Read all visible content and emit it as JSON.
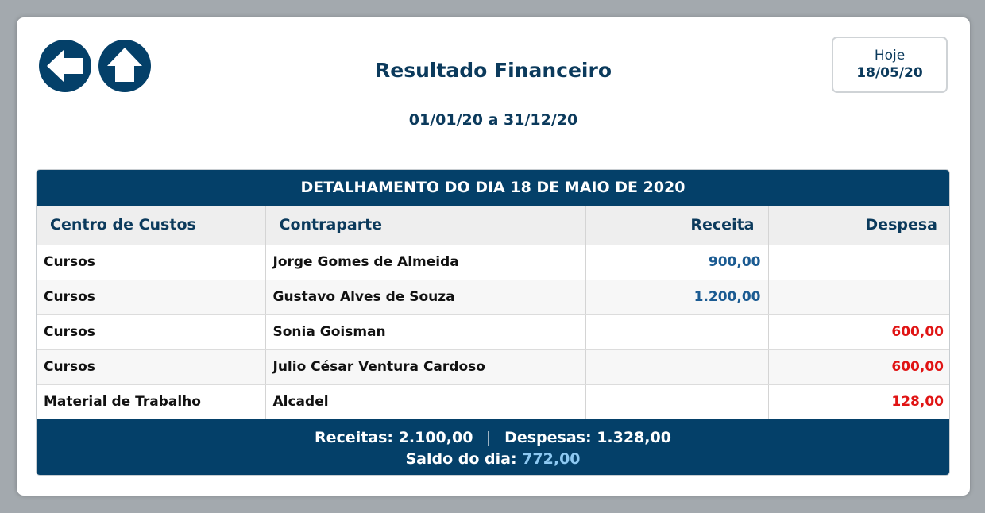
{
  "header": {
    "title": "Resultado Financeiro",
    "period": "01/01/20 a 31/12/20",
    "today_label": "Hoje",
    "today_date": "18/05/20"
  },
  "nav": {
    "back_icon": "arrow-left-icon",
    "home_icon": "arrow-up-icon"
  },
  "table": {
    "title": "DETALHAMENTO DO DIA 18 DE MAIO DE 2020",
    "columns": [
      "Centro de Custos",
      "Contraparte",
      "Receita",
      "Despesa"
    ],
    "rows": [
      {
        "centro": "Cursos",
        "contraparte": "Jorge Gomes de Almeida",
        "receita": "900,00",
        "despesa": ""
      },
      {
        "centro": "Cursos",
        "contraparte": "Gustavo Alves de Souza",
        "receita": "1.200,00",
        "despesa": ""
      },
      {
        "centro": "Cursos",
        "contraparte": "Sonia Goisman",
        "receita": "",
        "despesa": "600,00"
      },
      {
        "centro": "Cursos",
        "contraparte": "Julio César Ventura Cardoso",
        "receita": "",
        "despesa": "600,00"
      },
      {
        "centro": "Material de Trabalho",
        "contraparte": "Alcadel",
        "receita": "",
        "despesa": "128,00"
      }
    ]
  },
  "summary": {
    "receitas_label": "Receitas:",
    "receitas_value": "2.100,00",
    "separator": "|",
    "despesas_label": "Despesas:",
    "despesas_value": "1.328,00",
    "saldo_label": "Saldo do dia:",
    "saldo_value": "772,00"
  },
  "colors": {
    "primary": "#044069",
    "receita": "#1b5b92",
    "despesa": "#e01414",
    "saldo": "#8ec9f2"
  }
}
